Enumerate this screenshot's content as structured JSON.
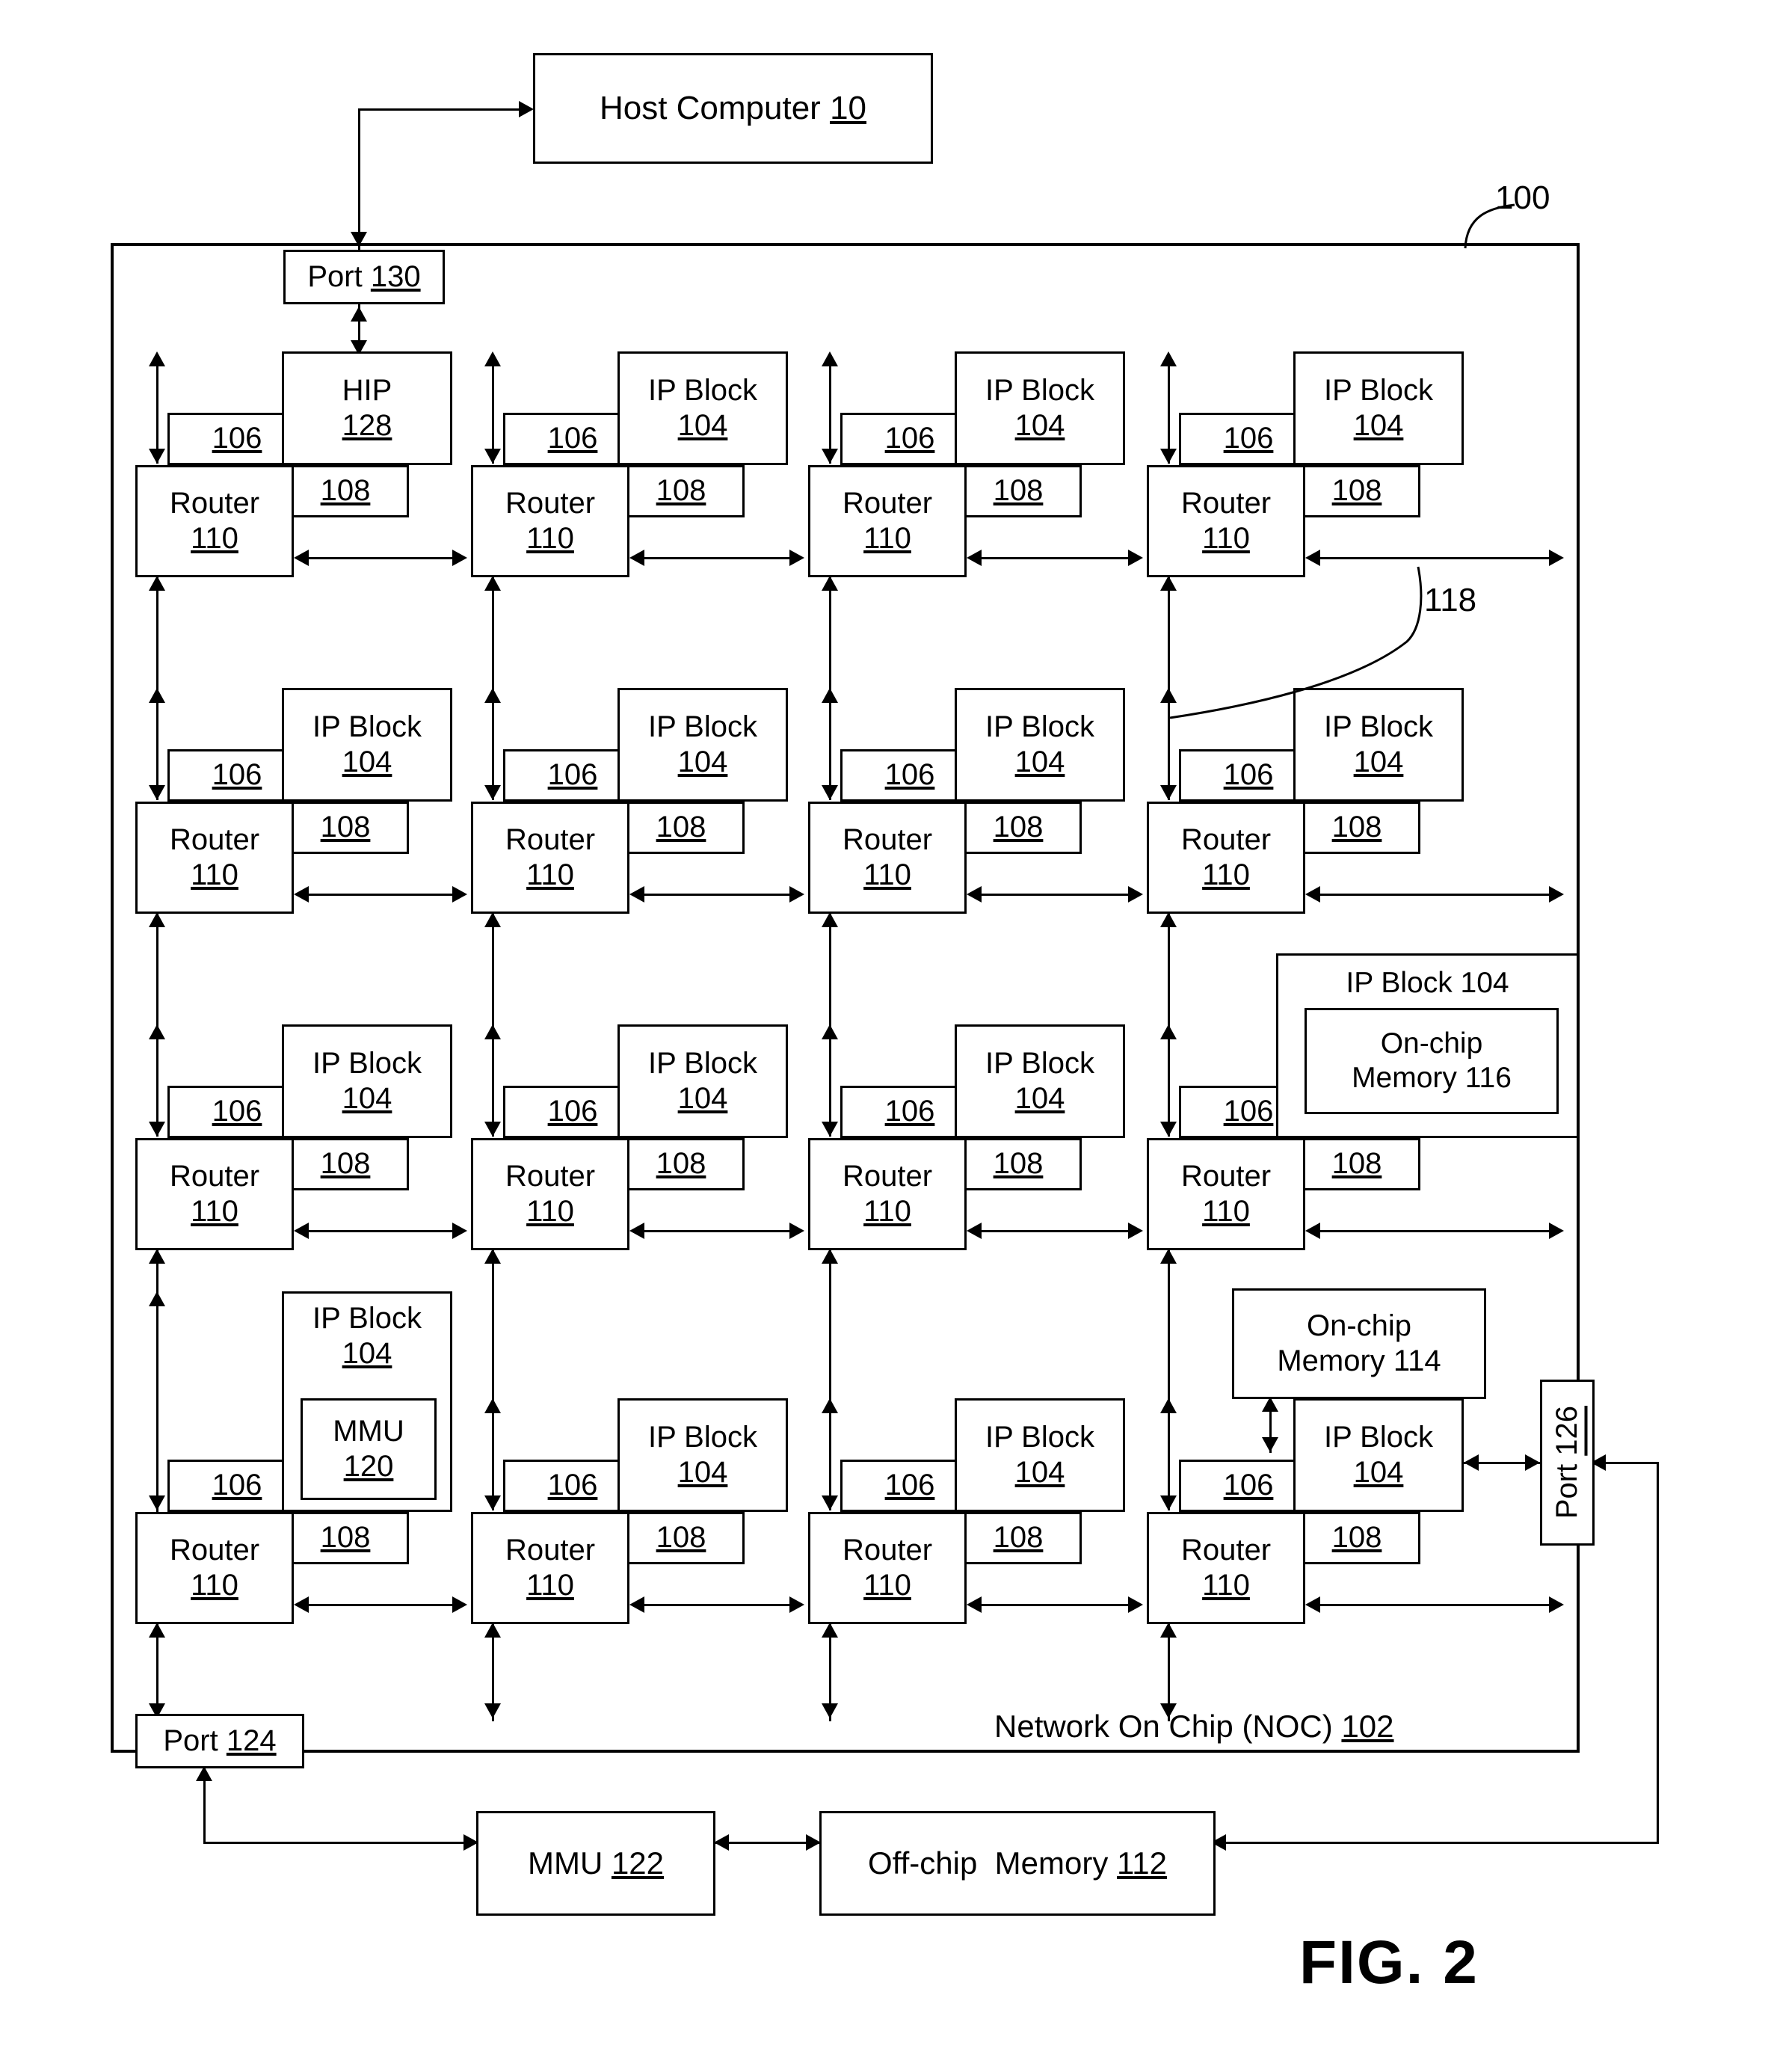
{
  "figure": {
    "caption": "FIG. 2",
    "reference_100": "100",
    "reference_118": "118"
  },
  "host": {
    "label": "Host Computer 10",
    "text": "Host Computer",
    "ref": "10"
  },
  "noc": {
    "title_text": "Network On Chip (NOC)",
    "title_ref": "102",
    "title_full": "Network On Chip (NOC) 102"
  },
  "ports": {
    "port130": "Port 130",
    "port124": "Port 124",
    "port126": "Port 126"
  },
  "external": {
    "mmu122": "MMU 122",
    "offchip_memory112": "Off-chip  Memory 112"
  },
  "labels": {
    "router": "Router",
    "router_ref": "110",
    "ip_block": "IP Block",
    "ip_block_ref": "104",
    "hip": "HIP",
    "hip_ref": "128",
    "ref_106": "106",
    "ref_108": "108",
    "onchip": "On-chip",
    "memory116": "Memory 116",
    "memory114": "Memory 114",
    "ip_block_104_inline": "IP Block 104",
    "mmu": "MMU",
    "mmu_ref": "120",
    "onchip_memory_114_l1": "On-chip",
    "onchip_memory_114_l2": "Memory 114"
  },
  "grid": {
    "rows": [
      {
        "cells": [
          {
            "kind": "hip",
            "block_l1": "HIP",
            "block_l2": "128",
            "agent": "106",
            "link": "108",
            "router_l1": "Router",
            "router_l2": "110"
          },
          {
            "kind": "plain",
            "block_l1": "IP Block",
            "block_l2": "104",
            "agent": "106",
            "link": "108",
            "router_l1": "Router",
            "router_l2": "110"
          },
          {
            "kind": "plain",
            "block_l1": "IP Block",
            "block_l2": "104",
            "agent": "106",
            "link": "108",
            "router_l1": "Router",
            "router_l2": "110"
          },
          {
            "kind": "plain",
            "block_l1": "IP Block",
            "block_l2": "104",
            "agent": "106",
            "link": "108",
            "router_l1": "Router",
            "router_l2": "110"
          }
        ]
      },
      {
        "cells": [
          {
            "kind": "plain",
            "block_l1": "IP Block",
            "block_l2": "104",
            "agent": "106",
            "link": "108",
            "router_l1": "Router",
            "router_l2": "110"
          },
          {
            "kind": "plain",
            "block_l1": "IP Block",
            "block_l2": "104",
            "agent": "106",
            "link": "108",
            "router_l1": "Router",
            "router_l2": "110"
          },
          {
            "kind": "plain",
            "block_l1": "IP Block",
            "block_l2": "104",
            "agent": "106",
            "link": "108",
            "router_l1": "Router",
            "router_l2": "110"
          },
          {
            "kind": "plain",
            "block_l1": "IP Block",
            "block_l2": "104",
            "agent": "106",
            "link": "108",
            "router_l1": "Router",
            "router_l2": "110"
          }
        ]
      },
      {
        "cells": [
          {
            "kind": "plain",
            "block_l1": "IP Block",
            "block_l2": "104",
            "agent": "106",
            "link": "108",
            "router_l1": "Router",
            "router_l2": "110"
          },
          {
            "kind": "plain",
            "block_l1": "IP Block",
            "block_l2": "104",
            "agent": "106",
            "link": "108",
            "router_l1": "Router",
            "router_l2": "110"
          },
          {
            "kind": "plain",
            "block_l1": "IP Block",
            "block_l2": "104",
            "agent": "106",
            "link": "108",
            "router_l1": "Router",
            "router_l2": "110"
          },
          {
            "kind": "memory",
            "block_l1": "IP Block 104",
            "inner_l1": "On-chip",
            "inner_l2": "Memory 116",
            "agent": "106",
            "link": "108",
            "router_l1": "Router",
            "router_l2": "110"
          }
        ]
      },
      {
        "cells": [
          {
            "kind": "mmu",
            "block_l1": "IP Block",
            "block_l2": "104",
            "inner_l1": "MMU",
            "inner_l2": "120",
            "agent": "106",
            "link": "108",
            "router_l1": "Router",
            "router_l2": "110"
          },
          {
            "kind": "plain",
            "block_l1": "IP Block",
            "block_l2": "104",
            "agent": "106",
            "link": "108",
            "router_l1": "Router",
            "router_l2": "110"
          },
          {
            "kind": "plain",
            "block_l1": "IP Block",
            "block_l2": "104",
            "agent": "106",
            "link": "108",
            "router_l1": "Router",
            "router_l2": "110"
          },
          {
            "kind": "plain",
            "block_l1": "IP Block",
            "block_l2": "104",
            "agent": "106",
            "link": "108",
            "router_l1": "Router",
            "router_l2": "110"
          }
        ]
      }
    ]
  },
  "colors": {
    "ink": "#000000",
    "paper": "#ffffff"
  }
}
